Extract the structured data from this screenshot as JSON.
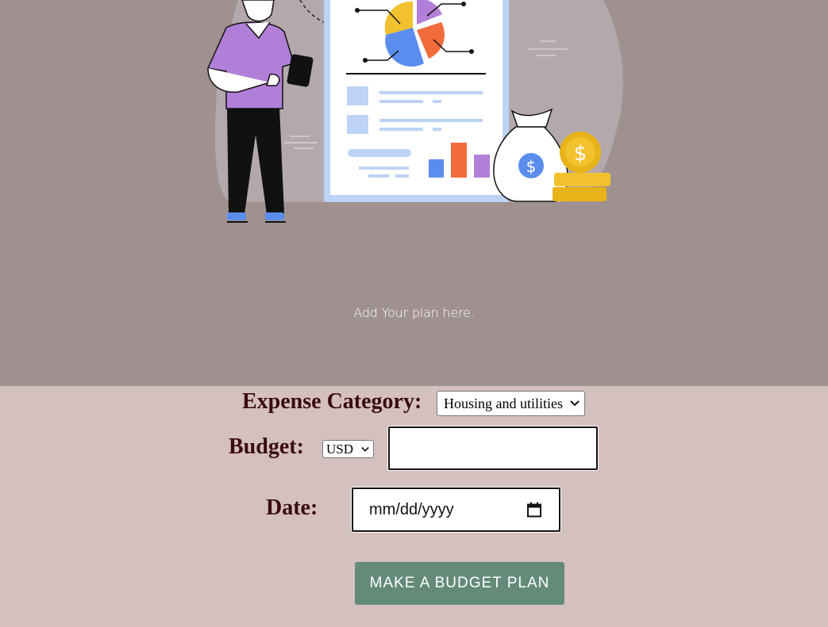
{
  "hero": {
    "caption": "Add Your plan here.",
    "illustration_icons": [
      "person-with-phone-icon",
      "report-document-icon",
      "pie-chart-icon",
      "bar-chart-icon",
      "money-bag-icon",
      "gold-coins-icon"
    ],
    "coin_symbol": "$"
  },
  "form": {
    "category_label": "Expense Category:",
    "category_value": "Housing and utilities",
    "budget_label": "Budget:",
    "currency_value": "USD",
    "budget_value": "",
    "date_label": "Date:",
    "date_placeholder": "mm/dd/yyyy",
    "submit_label": "MAKE A BUDGET PLAN"
  },
  "colors": {
    "hero_bg": "#9f918f",
    "page_bg": "#d5c0c0",
    "label_text": "#3a0c0c",
    "button_bg": "#648b7a"
  }
}
